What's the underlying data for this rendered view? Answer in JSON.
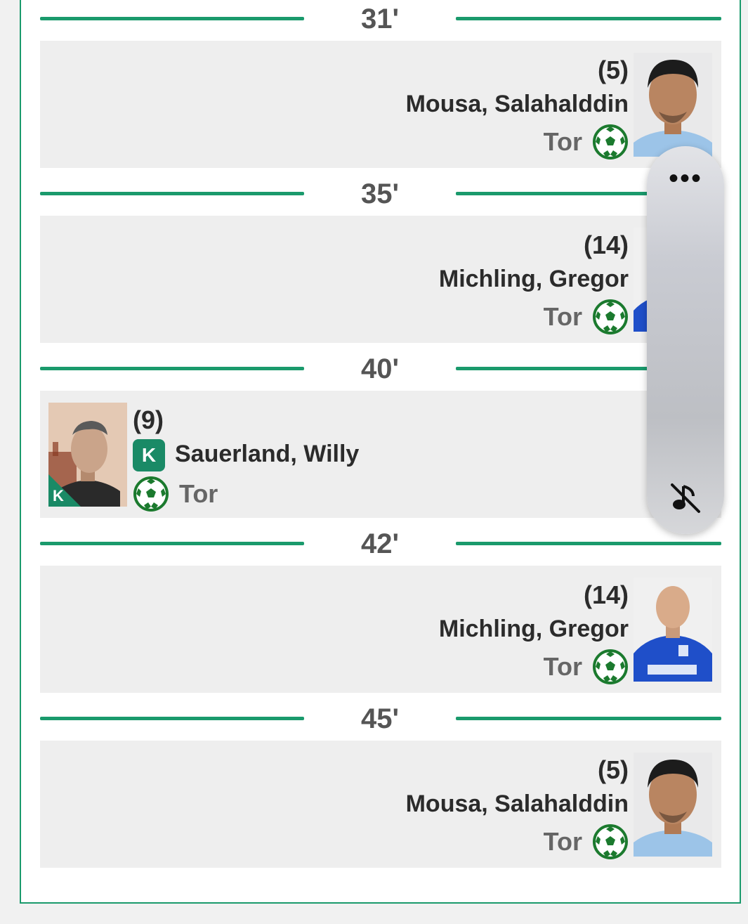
{
  "colors": {
    "accent": "#1a9a6c",
    "card": "#eeeeee",
    "badge": "#1a8a66"
  },
  "timeline": [
    {
      "minute": "31'",
      "side": "right",
      "number": "(5)",
      "name": "Mousa, Salahalddin",
      "type": "Tor",
      "captain": false
    },
    {
      "minute": "35'",
      "side": "right",
      "number": "(14)",
      "name": "Michling, Gregor",
      "type": "Tor",
      "captain": false
    },
    {
      "minute": "40'",
      "side": "left",
      "number": "(9)",
      "name": "Sauerland, Willy",
      "type": "Tor",
      "captain": true,
      "captain_label": "K"
    },
    {
      "minute": "42'",
      "side": "right",
      "number": "(14)",
      "name": "Michling, Gregor",
      "type": "Tor",
      "captain": false
    },
    {
      "minute": "45'",
      "side": "right",
      "number": "(5)",
      "name": "Mousa, Salahalddin",
      "type": "Tor",
      "captain": false
    }
  ],
  "overlay": {
    "more_label": "•••",
    "mute_icon": "music-note-off-icon"
  }
}
